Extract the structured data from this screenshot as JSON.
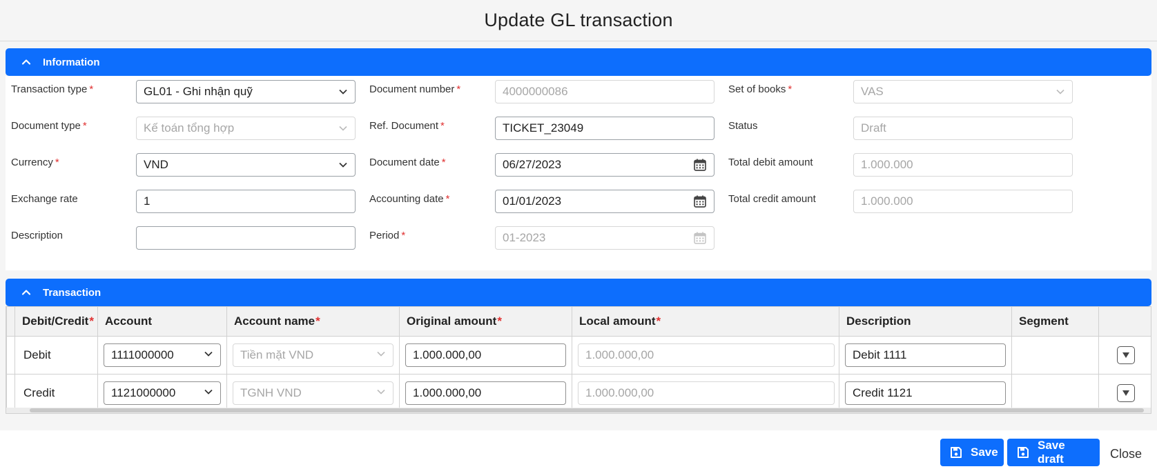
{
  "modal": {
    "title": "Update GL transaction"
  },
  "sections": {
    "information": "Information",
    "transaction": "Transaction"
  },
  "form": {
    "transaction_type": {
      "label": "Transaction type",
      "value": "GL01 - Ghi nhận quỹ"
    },
    "document_type": {
      "label": "Document type",
      "value": "Kế toán tổng hợp"
    },
    "currency": {
      "label": "Currency",
      "value": "VND"
    },
    "exchange_rate": {
      "label": "Exchange rate",
      "value": "1"
    },
    "description": {
      "label": "Description",
      "value": ""
    },
    "document_number": {
      "label": "Document number",
      "value": "4000000086"
    },
    "ref_document": {
      "label": "Ref. Document",
      "value": "TICKET_23049"
    },
    "document_date": {
      "label": "Document date",
      "value": "06/27/2023"
    },
    "accounting_date": {
      "label": "Accounting date",
      "value": "01/01/2023"
    },
    "period": {
      "label": "Period",
      "value": "01-2023"
    },
    "set_of_books": {
      "label": "Set of books",
      "value": "VAS"
    },
    "status": {
      "label": "Status",
      "value": "Draft"
    },
    "total_debit": {
      "label": "Total debit amount",
      "value": "1.000.000"
    },
    "total_credit": {
      "label": "Total credit amount",
      "value": "1.000.000"
    }
  },
  "grid": {
    "columns": {
      "debit_credit": "Debit/Credit",
      "account": "Account",
      "account_name": "Account name",
      "original_amount": "Original amount",
      "local_amount": "Local amount",
      "description": "Description",
      "segment": "Segment"
    },
    "rows": [
      {
        "debit_credit": "Debit",
        "account": "1111000000",
        "account_name": "Tiền mặt VND",
        "original_amount": "1.000.000,00",
        "local_amount": "1.000.000,00",
        "description": "Debit 1111",
        "segment": ""
      },
      {
        "debit_credit": "Credit",
        "account": "1121000000",
        "account_name": "TGNH VND",
        "original_amount": "1.000.000,00",
        "local_amount": "1.000.000,00",
        "description": "Credit 1121",
        "segment": ""
      }
    ]
  },
  "footer": {
    "save": "Save",
    "save_draft": "Save draft",
    "close": "Close"
  },
  "colors": {
    "primary": "#0d6efd",
    "required": "#e03131"
  }
}
